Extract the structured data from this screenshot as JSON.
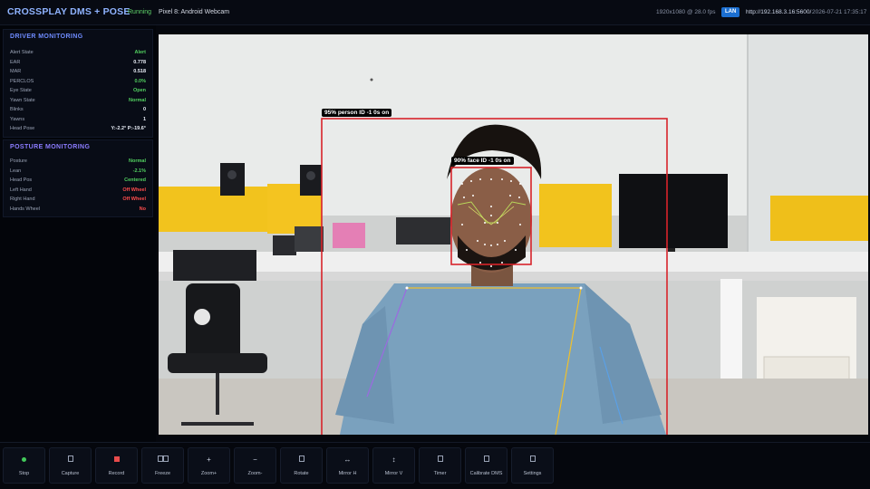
{
  "header": {
    "title": "CROSSPLAY DMS + POSE",
    "status": "Running",
    "device": "Pixel 8: Android Webcam",
    "resolution": "1920x1080 @ 28.0 fps",
    "lan_badge": "LAN",
    "url": "http://192.168.3.16:5600/",
    "datetime": "2026-07-21 17:35:17"
  },
  "driver_monitoring": {
    "title": "DRIVER MONITORING",
    "rows": [
      {
        "label": "Alert State",
        "value": "Alert"
      },
      {
        "label": "EAR",
        "value": "0.778"
      },
      {
        "label": "MAR",
        "value": "0.518"
      },
      {
        "label": "PERCLOS",
        "value": "0.0%"
      },
      {
        "label": "Eye State",
        "value": "Open"
      },
      {
        "label": "Yawn State",
        "value": "Normal"
      },
      {
        "label": "Blinks",
        "value": "0"
      },
      {
        "label": "Yawns",
        "value": "1"
      },
      {
        "label": "Head Pose",
        "value": "Y:-2.2° P:-19.6°"
      }
    ]
  },
  "posture_monitoring": {
    "title": "POSTURE MONITORING",
    "rows": [
      {
        "label": "Posture",
        "value": "Normal"
      },
      {
        "label": "Lean",
        "value": "-2.1%"
      },
      {
        "label": "Head Pos",
        "value": "Centered"
      },
      {
        "label": "Left Hand",
        "value": "Off Wheel"
      },
      {
        "label": "Right Hand",
        "value": "Off Wheel"
      },
      {
        "label": "Hands Wheel",
        "value": "No"
      }
    ]
  },
  "detections": {
    "person_label": "95% person ID -1 0s on",
    "face_label": "90% face ID -1 0s on"
  },
  "toolbar": {
    "buttons": [
      {
        "label": "Stop",
        "icon": "stop-dot-icon"
      },
      {
        "label": "Capture",
        "icon": "capture-icon"
      },
      {
        "label": "Record",
        "icon": "record-icon"
      },
      {
        "label": "Freeze",
        "icon": "freeze-icon"
      },
      {
        "label": "Zoom+",
        "icon": "zoom-in-icon"
      },
      {
        "label": "Zoom-",
        "icon": "zoom-out-icon"
      },
      {
        "label": "Rotate",
        "icon": "rotate-icon"
      },
      {
        "label": "Mirror H",
        "icon": "mirror-h-icon"
      },
      {
        "label": "Mirror V",
        "icon": "mirror-v-icon"
      },
      {
        "label": "Timer",
        "icon": "timer-icon"
      },
      {
        "label": "Calibrate DMS",
        "icon": "calibrate-icon"
      },
      {
        "label": "Settings",
        "icon": "settings-icon"
      }
    ]
  },
  "colors": {
    "accent": "#8fb3ff",
    "status_ok": "#52d160",
    "status_bad": "#ff4c4c",
    "detection_box": "#d8232a",
    "lan_badge": "#1c6fd1"
  }
}
